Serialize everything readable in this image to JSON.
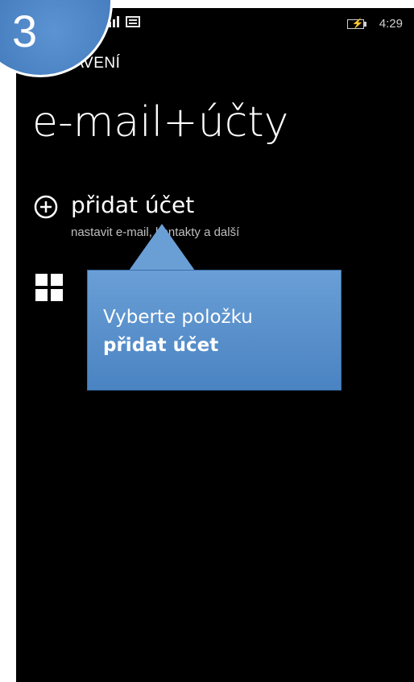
{
  "step": {
    "number": "3"
  },
  "status_bar": {
    "time": "4:29"
  },
  "header": {
    "section_label": "NASTAVENÍ",
    "title": "e-mail+účty"
  },
  "account_item": {
    "title": "přidat účet",
    "subtitle": "nastavit e-mail, kontakty a další"
  },
  "callout": {
    "line1": "Vyberte položku",
    "line2_bold": "přidat účet"
  },
  "colors": {
    "background": "#000000",
    "accent_blue": "#4a83c2",
    "text": "#ffffff"
  },
  "icons": {
    "plus": "add-circle-icon",
    "windows": "windows-logo-icon",
    "battery": "battery-charging-icon",
    "signal": "signal-icon",
    "message": "message-icon"
  }
}
